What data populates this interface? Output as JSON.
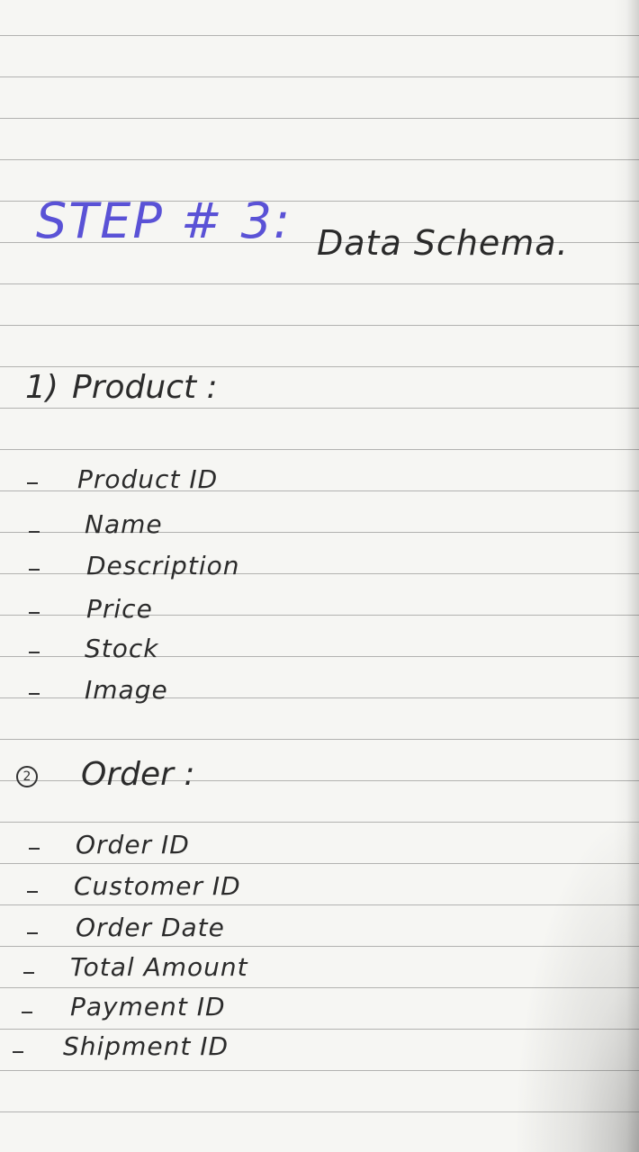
{
  "title": {
    "step": "STEP # 3:",
    "subject": "Data Schema."
  },
  "sections": [
    {
      "number": "1)",
      "heading": "Product :",
      "items": [
        "Product ID",
        "Name",
        "Description",
        "Price",
        "Stock",
        "Image"
      ]
    },
    {
      "number": "2",
      "heading": "Order :",
      "items": [
        "Order ID",
        "Customer ID",
        "Order Date",
        "Total Amount",
        "Payment ID",
        "Shipment ID"
      ]
    }
  ],
  "colors": {
    "title_ink": "#5a52d6",
    "ink": "#2b2b2b",
    "paper": "#f6f6f3",
    "rule": "#5f5f5f"
  }
}
